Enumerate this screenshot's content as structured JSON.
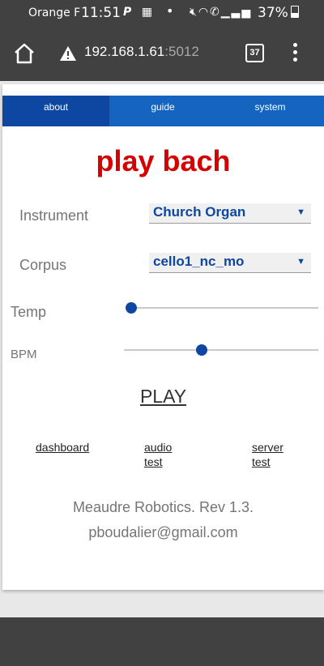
{
  "status_bar": {
    "carrier": "Orange F",
    "time": "11:51",
    "notification_icons": [
      "pinterest-icon",
      "qr-code-icon"
    ],
    "system_icons": [
      "mute-icon",
      "wifi-icon",
      "wifi-call-icon",
      "signal-icon"
    ],
    "battery": "37%"
  },
  "browser": {
    "url_host": "192.168.1.61",
    "url_port": ":5012",
    "tab_count": "37",
    "security": "warning"
  },
  "nav": {
    "tabs": [
      {
        "label": "about",
        "active": true
      },
      {
        "label": "guide",
        "active": false
      },
      {
        "label": "system",
        "active": false
      }
    ],
    "color": "#1565c0",
    "active_color": "#0d47a1"
  },
  "main": {
    "title": "play bach",
    "title_color": "#d50000",
    "instrument": {
      "label": "Instrument",
      "value": "Church Organ"
    },
    "corpus": {
      "label": "Corpus",
      "value": "cello1_nc_mo"
    },
    "temp": {
      "label": "Temp",
      "value_fraction": 0.03
    },
    "bpm": {
      "label": "BPM",
      "value_fraction": 0.4
    },
    "play_label": "PLAY",
    "links": [
      {
        "line1": "dashboard",
        "line2": ""
      },
      {
        "line1": "audio",
        "line2": "test"
      },
      {
        "line1": "server",
        "line2": "test"
      }
    ]
  },
  "footer": {
    "line1": "Meaudre Robotics. Rev 1.3.",
    "line2": "pboudalier@gmail.com"
  }
}
